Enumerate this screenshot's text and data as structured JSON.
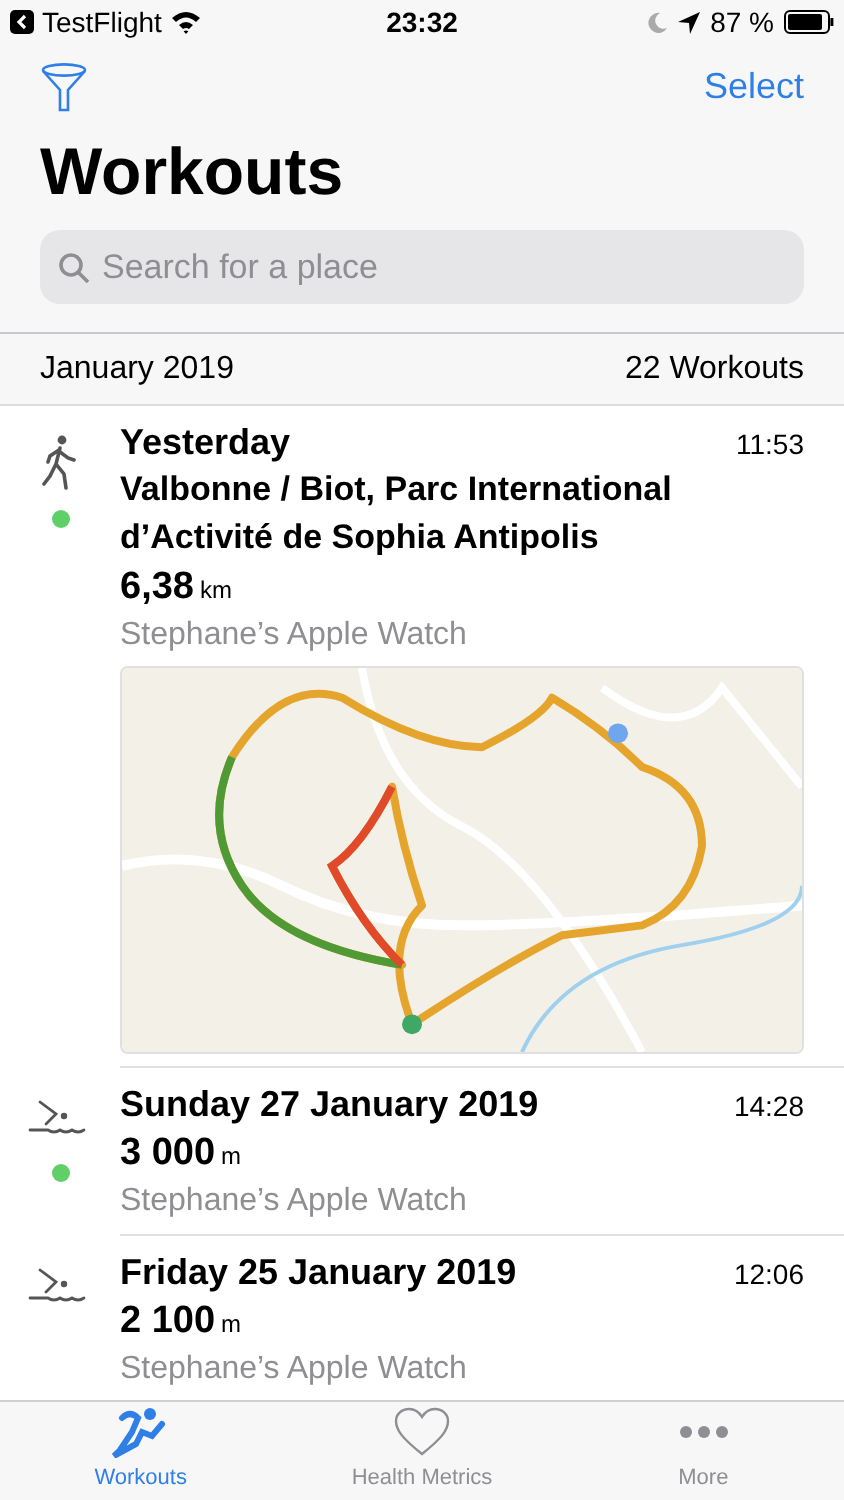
{
  "status_bar": {
    "back_app": "TestFlight",
    "time": "23:32",
    "battery": "87 %"
  },
  "nav": {
    "select": "Select"
  },
  "title": "Workouts",
  "search": {
    "placeholder": "Search for a place"
  },
  "section": {
    "month": "January 2019",
    "count": "22 Workouts"
  },
  "workouts": [
    {
      "kind": "walk",
      "synced": true,
      "date": "Yesterday",
      "time": "11:53",
      "place": "Valbonne / Biot, Parc International d’Activité de Sophia Antipolis",
      "distance": "6,38",
      "unit": "km",
      "source": "Stephane’s Apple Watch"
    },
    {
      "kind": "swim",
      "synced": true,
      "date": "Sunday 27 January 2019",
      "time": "14:28",
      "distance": "3 000",
      "unit": "m",
      "source": "Stephane’s Apple Watch"
    },
    {
      "kind": "swim",
      "synced": false,
      "date": "Friday 25 January 2019",
      "time": "12:06",
      "distance": "2 100",
      "unit": "m",
      "source": "Stephane’s Apple Watch"
    }
  ],
  "tabs": [
    {
      "label": "Workouts",
      "kind": "runner",
      "selected": true
    },
    {
      "label": "Health Metrics",
      "kind": "heart",
      "selected": false
    },
    {
      "label": "More",
      "kind": "more",
      "selected": false
    }
  ]
}
